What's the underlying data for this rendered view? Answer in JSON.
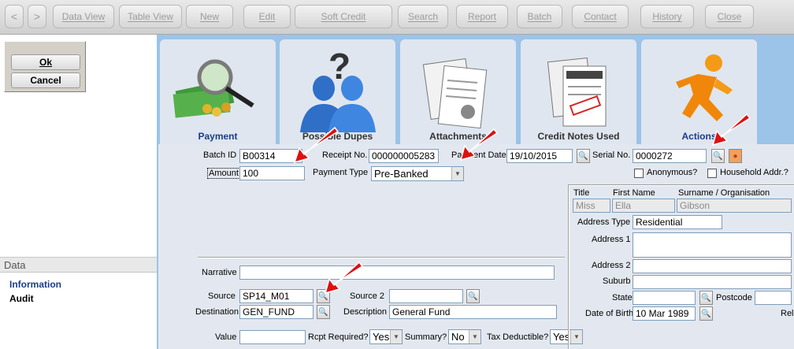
{
  "toolbar": {
    "back": "<",
    "forward": ">",
    "items": [
      "Data View",
      "Table View",
      "New",
      "Edit",
      "Soft Credit",
      "Search",
      "Report",
      "Batch",
      "Contact",
      "History",
      "Close"
    ]
  },
  "dialog": {
    "ok": "Ok",
    "cancel": "Cancel"
  },
  "sidebar": {
    "section": "Data",
    "items": [
      "Information",
      "Audit"
    ]
  },
  "tabs": [
    "Payment",
    "Possible Dupes",
    "Attachments",
    "Credit Notes Used",
    "Actions"
  ],
  "form": {
    "batch_id_label": "Batch ID",
    "batch_id": "B00314",
    "receipt_no_label": "Receipt No.",
    "receipt_no": "000000005283",
    "payment_date_label": "Payment Date",
    "payment_date": "19/10/2015",
    "serial_no_label": "Serial No.",
    "serial_no": "0000272",
    "amount_label": "Amount",
    "amount": "100",
    "payment_type_label": "Payment Type",
    "payment_type": "Pre-Banked",
    "anonymous_label": "Anonymous?",
    "household_label": "Household Addr.?",
    "narrative_label": "Narrative",
    "narrative": "",
    "source_label": "Source",
    "source": "SP14_M01",
    "source2_label": "Source 2",
    "source2": "",
    "destination_label": "Destination",
    "destination": "GEN_FUND",
    "description_label": "Description",
    "description": "General Fund",
    "value_label": "Value",
    "value": "",
    "rcpt_required_label": "Rcpt Required?",
    "rcpt_required": "Yes",
    "summary_label": "Summary?",
    "summary": "No",
    "tax_deductible_label": "Tax Deductible?",
    "tax_deductible": "Yes"
  },
  "contact": {
    "title_label": "Title",
    "title": "Miss",
    "first_name_label": "First Name",
    "first_name": "Ella",
    "surname_label": "Surname / Organisation",
    "surname": "Gibson",
    "address_type_label": "Address Type",
    "address_type": "Residential",
    "address1_label": "Address 1",
    "address2_label": "Address 2",
    "suburb_label": "Suburb",
    "state_label": "State",
    "postcode_label": "Postcode",
    "dob_label": "Date of Birth",
    "dob": "10 Mar 1989",
    "rel_label": "Rel"
  },
  "colors": {
    "accent_arrow": "#e01010",
    "tab_blue": "#1a3c8c",
    "panel_bg": "#9cc3e8"
  }
}
